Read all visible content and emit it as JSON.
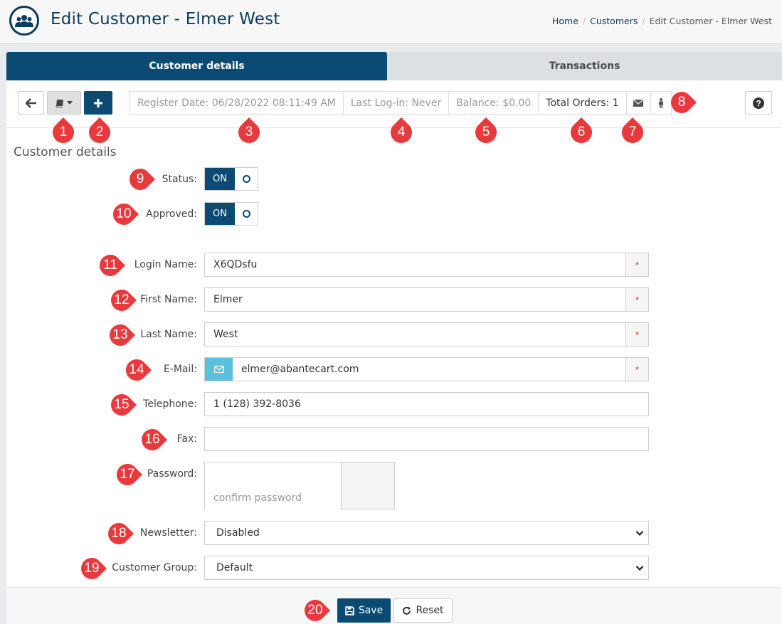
{
  "header": {
    "title": "Edit Customer - Elmer West",
    "breadcrumb": {
      "home": "Home",
      "customers": "Customers",
      "current": "Edit Customer - Elmer West"
    },
    "logo_icon": "customers-icon"
  },
  "tabs": {
    "details": "Customer details",
    "transactions": "Transactions"
  },
  "toolbar": {
    "register_date": "Register Date: 06/28/2022 08:11:49 AM",
    "last_login": "Last Log-in: Never",
    "balance": "Balance: $0.00",
    "total_orders": "Total Orders: 1"
  },
  "section_title": "Customer details",
  "form": {
    "status": {
      "label": "Status:",
      "on": "ON"
    },
    "approved": {
      "label": "Approved:",
      "on": "ON"
    },
    "login_name": {
      "label": "Login Name:",
      "value": "X6QDsfu",
      "required": "*"
    },
    "first_name": {
      "label": "First Name:",
      "value": "Elmer",
      "required": "*"
    },
    "last_name": {
      "label": "Last Name:",
      "value": "West",
      "required": "*"
    },
    "email": {
      "label": "E-Mail:",
      "value": "elmer@abantecart.com",
      "required": "*"
    },
    "telephone": {
      "label": "Telephone:",
      "value": "1 (128) 392-8036"
    },
    "fax": {
      "label": "Fax:",
      "value": ""
    },
    "password": {
      "label": "Password:",
      "confirm_placeholder": "confirm password"
    },
    "newsletter": {
      "label": "Newsletter:",
      "value": "Disabled"
    },
    "customer_group": {
      "label": "Customer Group:",
      "value": "Default"
    }
  },
  "footer": {
    "save": "Save",
    "reset": "Reset"
  },
  "badges": [
    "1",
    "2",
    "3",
    "4",
    "5",
    "6",
    "7",
    "8",
    "9",
    "10",
    "11",
    "12",
    "13",
    "14",
    "15",
    "16",
    "17",
    "18",
    "19",
    "20"
  ],
  "colors": {
    "navy": "#0b4a72",
    "badge": "#e8393c",
    "email_addon": "#5bc0de"
  }
}
